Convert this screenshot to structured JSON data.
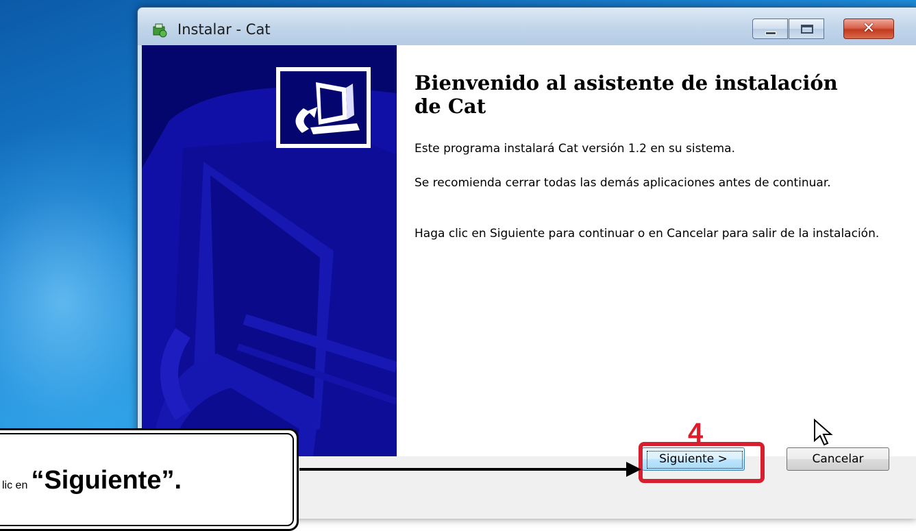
{
  "window": {
    "title": "Instalar - Cat"
  },
  "wizard": {
    "heading": "Bienvenido al asistente de instalación de Cat",
    "paragraph1": "Este programa instalará Cat versión 1.2 en su sistema.",
    "paragraph2": "Se recomienda cerrar todas las demás aplicaciones antes de continuar.",
    "paragraph3": "Haga clic en Siguiente para continuar o en Cancelar para salir de la instalación."
  },
  "buttons": {
    "next": "Siguiente >",
    "cancel": "Cancelar"
  },
  "annotation": {
    "step_number": "4",
    "instruction_prefix": "lic en",
    "instruction_bold": "“Siguiente”.",
    "highlight_color": "#d61f2f"
  },
  "icons": {
    "title_icon": "installer-icon",
    "wizard_icon": "computer-install-icon",
    "cursor": "mouse-pointer-icon"
  },
  "colors": {
    "wizard_banner": "#0a0a8a",
    "desktop": "#1a86d6"
  }
}
